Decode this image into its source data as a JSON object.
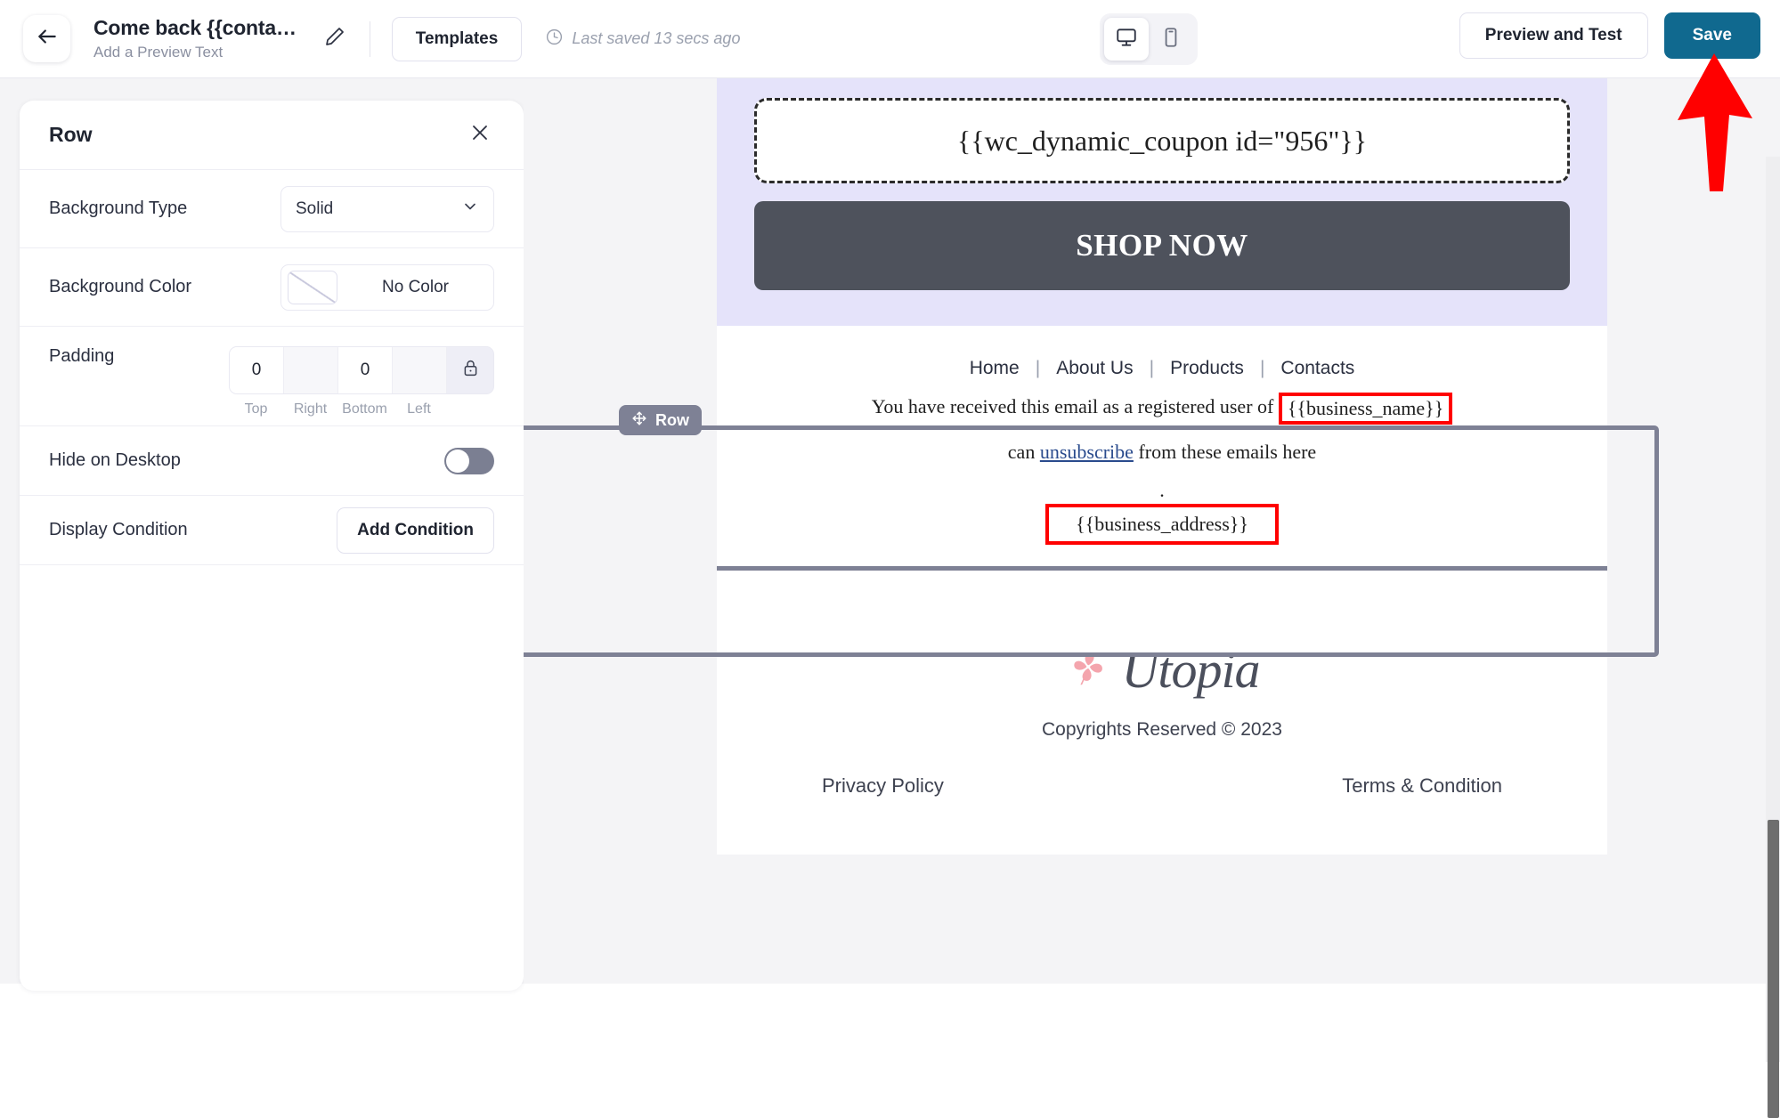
{
  "topbar": {
    "back_icon": "arrow-left-icon",
    "campaign_title": "Come back {{conta…",
    "preview_text_placeholder": "Add a Preview Text",
    "edit_icon": "pencil-icon",
    "templates_label": "Templates",
    "clock_icon": "clock-icon",
    "last_saved": "Last saved 13 secs ago",
    "desktop_icon": "monitor-icon",
    "mobile_icon": "phone-icon",
    "preview_label": "Preview and Test",
    "save_label": "Save",
    "save_bg": "#10698f"
  },
  "panel": {
    "title": "Row",
    "close_icon": "close-icon",
    "background_type": {
      "label": "Background Type",
      "value": "Solid",
      "chevron_icon": "chevron-down-icon"
    },
    "background_color": {
      "label": "Background Color",
      "value": "No Color",
      "swatch_icon": "no-color-swatch-icon"
    },
    "padding": {
      "label": "Padding",
      "values": [
        "0",
        "",
        "0",
        ""
      ],
      "sides": [
        "Top",
        "Right",
        "Bottom",
        "Left"
      ],
      "lock_icon": "lock-icon"
    },
    "hide_on_desktop": {
      "label": "Hide on Desktop",
      "state": "off"
    },
    "display_condition": {
      "label": "Display Condition",
      "button_label": "Add Condition"
    }
  },
  "canvas": {
    "row_badge": {
      "label": "Row",
      "move_icon": "move-arrows-icon"
    },
    "coupon_row": {
      "background": "#e5e3fa",
      "coupon_text": "{{wc_dynamic_coupon id=\"956\"}}",
      "cta_label": "SHOP NOW",
      "cta_bg": "#4e525c"
    },
    "footer_row": {
      "nav": [
        "Home",
        "About Us",
        "Products",
        "Contacts"
      ],
      "separator": "|",
      "line1_prefix": "You have received this email as a registered user of",
      "business_name": "{{business_name}}",
      "line2_pre": "can",
      "unsubscribe": "unsubscribe",
      "line2_post": "from these emails here",
      "dot": ".",
      "business_address": "{{business_address}}",
      "highlight_color": "#ff0000"
    },
    "brand_row": {
      "logo_icon": "clover-icon",
      "brand_name": "Utopia",
      "copyright": "Copyrights Reserved © 2023",
      "privacy_label": "Privacy Policy",
      "terms_label": "Terms & Condition"
    }
  },
  "annotation": {
    "arrow_icon": "red-up-arrow",
    "arrow_color": "#ff0000"
  }
}
